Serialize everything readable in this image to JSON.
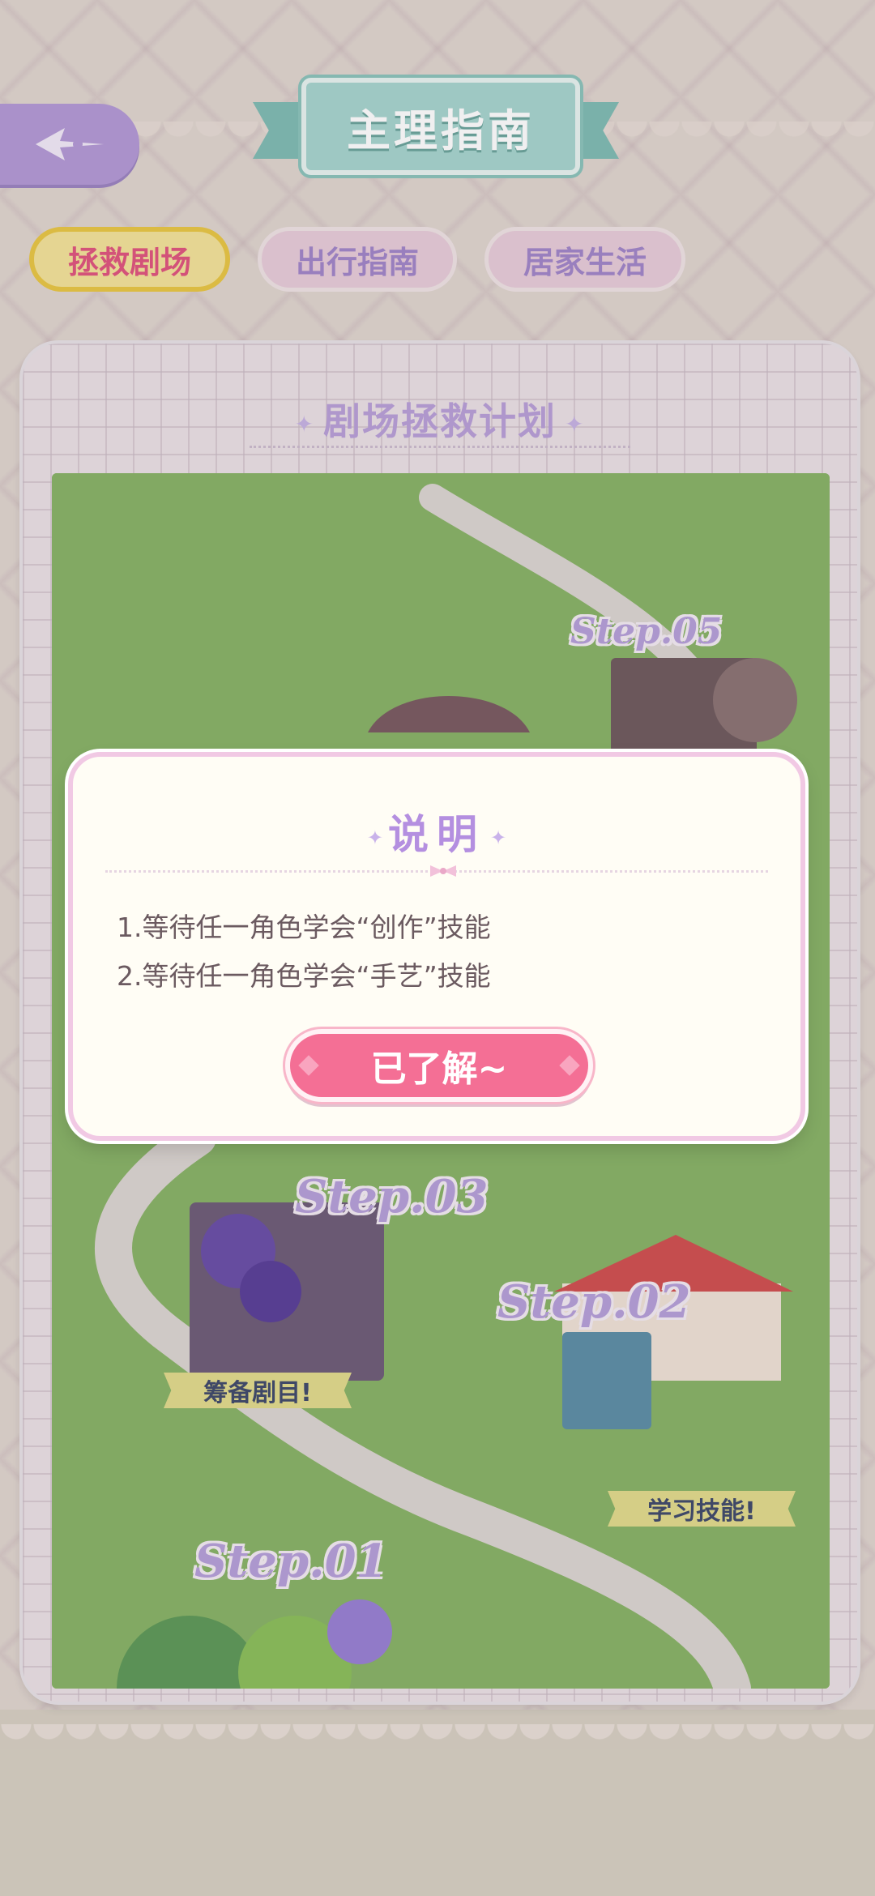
{
  "header": {
    "title": "主理指南"
  },
  "tabs": [
    {
      "label": "拯救剧场",
      "active": true
    },
    {
      "label": "出行指南",
      "active": false
    },
    {
      "label": "居家生活",
      "active": false
    }
  ],
  "card": {
    "title": "剧场拯救计划"
  },
  "map": {
    "steps": [
      {
        "label": "Step.05"
      },
      {
        "label": "Step.03",
        "banner": "筹备剧目!"
      },
      {
        "label": "Step.02",
        "banner": "学习技能!"
      },
      {
        "label": "Step.01"
      }
    ]
  },
  "dialog": {
    "title": "说明",
    "lines": [
      "1.等待任一角色学会“创作”技能",
      "2.等待任一角色学会“手艺”技能"
    ],
    "confirm_label": "已了解~"
  },
  "colors": {
    "accent_pink": "#f46f95",
    "accent_purple": "#b48fe0",
    "ribbon_teal": "#a7d5cf",
    "map_green": "#88b466"
  }
}
